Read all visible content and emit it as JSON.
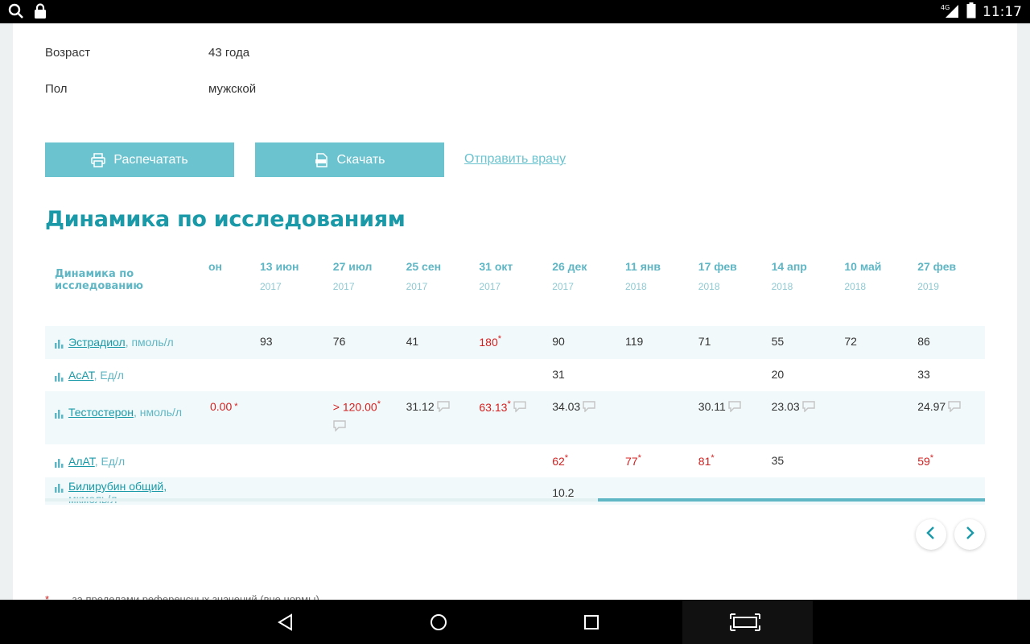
{
  "status_bar": {
    "time": "11:17",
    "network": "4G"
  },
  "patient": {
    "age_label": "Возраст",
    "age_value": "43 года",
    "sex_label": "Пол",
    "sex_value": "мужской"
  },
  "actions": {
    "print_label": "Распечатать",
    "download_label": "Скачать",
    "send_label": "Отправить врачу"
  },
  "section_title": "Динамика по исследованиям",
  "table": {
    "fixed_header": "Динамика по исследованию",
    "partial_column": {
      "date": "он",
      "values": {
        "testosterone": "0.00"
      }
    },
    "columns": [
      {
        "date": "13 июн",
        "year": "2017"
      },
      {
        "date": "27 июл",
        "year": "2017"
      },
      {
        "date": "25 сен",
        "year": "2017"
      },
      {
        "date": "31 окт",
        "year": "2017"
      },
      {
        "date": "26 дек",
        "year": "2017"
      },
      {
        "date": "11 янв",
        "year": "2018"
      },
      {
        "date": "17 фев",
        "year": "2018"
      },
      {
        "date": "14 апр",
        "year": "2018"
      },
      {
        "date": "10 май",
        "year": "2018"
      },
      {
        "date": "27 фев",
        "year": "2019"
      }
    ],
    "rows": [
      {
        "name": "Эстрадиол",
        "unit": ", пмоль/л",
        "values": [
          "93",
          "76",
          "41",
          "180",
          "90",
          "119",
          "71",
          "55",
          "72",
          "86"
        ],
        "flags": [
          false,
          false,
          false,
          true,
          false,
          false,
          false,
          false,
          false,
          false
        ],
        "comments": [
          false,
          false,
          false,
          false,
          false,
          false,
          false,
          false,
          false,
          false
        ]
      },
      {
        "name": "АсАТ",
        "unit": ", Ед/л",
        "values": [
          "",
          "",
          "",
          "",
          "31",
          "",
          "",
          "20",
          "",
          "33"
        ],
        "flags": [
          false,
          false,
          false,
          false,
          false,
          false,
          false,
          false,
          false,
          false
        ],
        "comments": [
          false,
          false,
          false,
          false,
          false,
          false,
          false,
          false,
          false,
          false
        ]
      },
      {
        "name": "Тестостерон",
        "unit": ", нмоль/л",
        "values": [
          "",
          "> 120.00",
          "31.12",
          "63.13",
          "34.03",
          "",
          "30.11",
          "23.03",
          "",
          "24.97"
        ],
        "flags": [
          false,
          true,
          false,
          true,
          false,
          false,
          false,
          false,
          false,
          false
        ],
        "comments": [
          false,
          true,
          true,
          true,
          true,
          false,
          true,
          true,
          false,
          true
        ]
      },
      {
        "name": "АлАТ",
        "unit": ", Ед/л",
        "values": [
          "",
          "",
          "",
          "",
          "62",
          "77",
          "81",
          "35",
          "",
          "59"
        ],
        "flags": [
          false,
          false,
          false,
          false,
          true,
          true,
          true,
          false,
          false,
          true
        ],
        "comments": [
          false,
          false,
          false,
          false,
          false,
          false,
          false,
          false,
          false,
          false
        ]
      },
      {
        "name": "Билирубин общий,",
        "unit": "мкмоль/л",
        "values": [
          "",
          "",
          "",
          "",
          "10.2",
          "",
          "",
          "",
          "",
          ""
        ],
        "flags": [
          false,
          false,
          false,
          false,
          false,
          false,
          false,
          false,
          false,
          false
        ],
        "comments": [
          false,
          false,
          false,
          false,
          false,
          false,
          false,
          false,
          false,
          false
        ]
      }
    ]
  },
  "footnote": {
    "marker": "*",
    "text": "— за пределами референсных значений (вне нормы)"
  },
  "colors": {
    "accent": "#1a9aa8",
    "button": "#6bc3cf",
    "out_of_range": "#d32020"
  }
}
